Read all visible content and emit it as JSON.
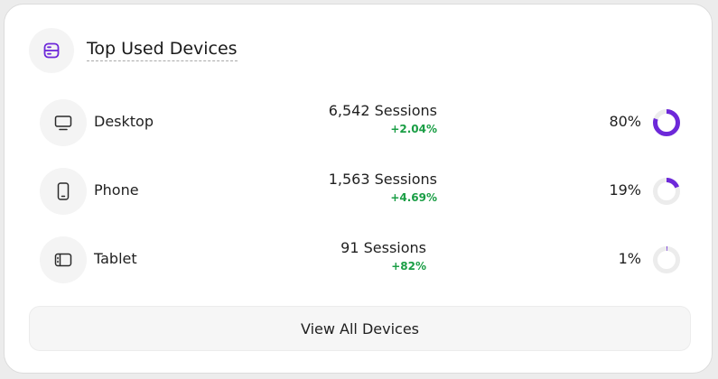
{
  "header": {
    "title": "Top Used Devices",
    "icon": "server-icon",
    "accent_color": "#6d28d9"
  },
  "devices": [
    {
      "name": "Desktop",
      "icon": "monitor-icon",
      "sessions": "6,542 Sessions",
      "change": "+2.04%",
      "percent_label": "80%",
      "percent_value": 80
    },
    {
      "name": "Phone",
      "icon": "phone-icon",
      "sessions": "1,563 Sessions",
      "change": "+4.69%",
      "percent_label": "19%",
      "percent_value": 19
    },
    {
      "name": "Tablet",
      "icon": "tablet-icon",
      "sessions": "91 Sessions",
      "change": "+82%",
      "percent_label": "1%",
      "percent_value": 1
    }
  ],
  "footer": {
    "view_all_label": "View All Devices"
  },
  "colors": {
    "donut_fill": "#6d28d9",
    "donut_track": "#ececec",
    "positive_change": "#1a9e45"
  }
}
